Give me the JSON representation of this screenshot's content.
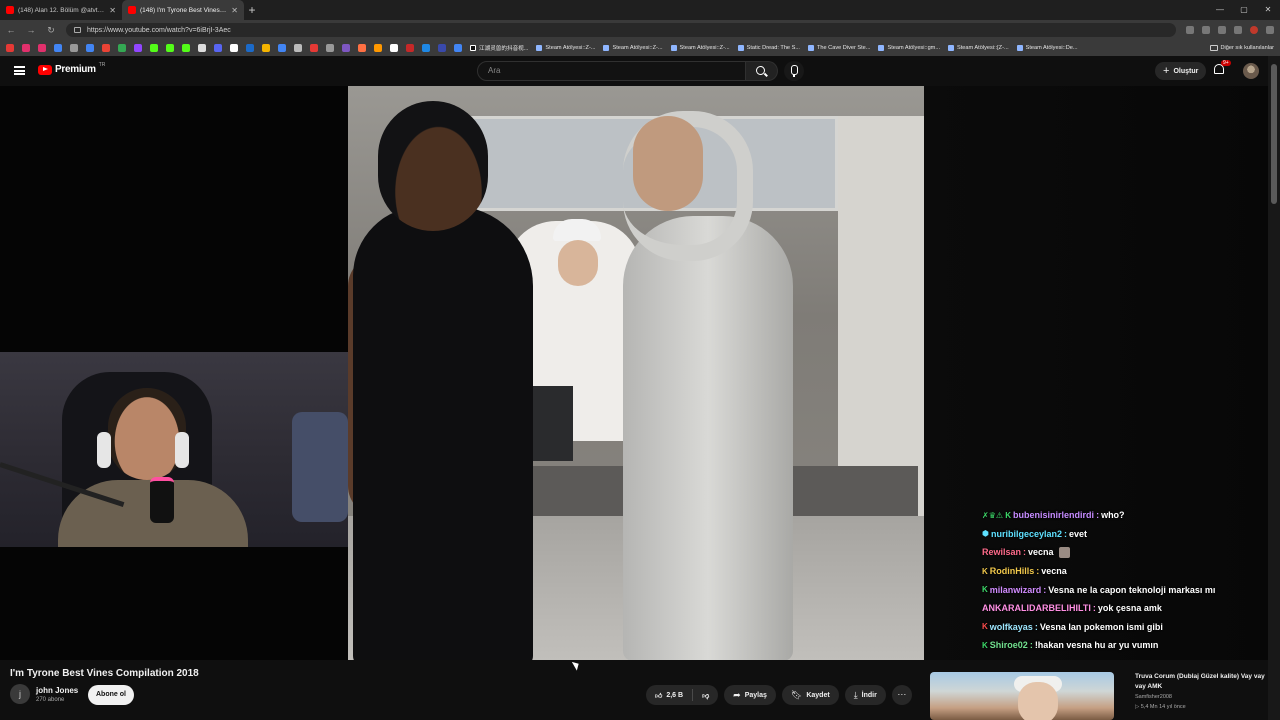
{
  "browser": {
    "tabs": [
      {
        "title": "(148) Alan 12. Bölüm @atvturkiye",
        "active": false
      },
      {
        "title": "(148) I'm Tyrone Best Vines Co",
        "active": true
      }
    ],
    "new_tab": "+",
    "url": "https://www.youtube.com/watch?v=6iBrjI-3Aec",
    "bookmarks": [
      "江湖灵兽的抖音视...",
      "Steam Atölyesi::Z-...",
      "Steam Atölyesi::Z-...",
      "Steam Atölyesi::Z-...",
      "Static Dread: The S...",
      "The Cave Diver Ste...",
      "Steam Atölyesi::gm...",
      "Steam Atölyesi::[Z-...",
      "Steam Atölyesi::De..."
    ],
    "bookmarks_other": "Diğer sık kullanılanlar"
  },
  "youtube": {
    "logo_text": "Premium",
    "logo_region": "TR",
    "search_placeholder": "Ara",
    "create_label": "Oluştur",
    "notif_count": "9+"
  },
  "chat": [
    {
      "badges": "✗♛⚠ K",
      "user": "bubenisinirlendirdi",
      "color": "#c58bff",
      "text": "who?"
    },
    {
      "badges": "⬢",
      "user": "nuribilgeceylan2",
      "color": "#5ee0ff",
      "text": "evet"
    },
    {
      "badges": "",
      "user": "Rewilsan",
      "color": "#ff6b8b",
      "text": "vecna",
      "emote": true
    },
    {
      "badges": "K",
      "user": "RodinHills",
      "color": "#f2c94c",
      "text": "vecna"
    },
    {
      "badges": "K",
      "user": "milanwizard",
      "color": "#d18cff",
      "text": "Vesna ne la capon teknoloji markası mı"
    },
    {
      "badges": "",
      "user": "ANKARALIDARBELIHILTI",
      "color": "#ff8fe3",
      "text": "yok çesna amk"
    },
    {
      "badges": "K",
      "user": "wolfkayas",
      "color": "#9ee7ff",
      "text": "Vesna  lan pokemon ismi gibi",
      "emote_mid": true
    },
    {
      "badges": "K",
      "user": "Shiroe02",
      "color": "#72e08f",
      "text": "!hakan vesna hu ar yu vumın"
    }
  ],
  "video": {
    "title": "I'm Tyrone Best Vines Compilation 2018",
    "channel_initial": "j",
    "channel": "john Jones",
    "subscribers": "270 abone",
    "subscribe_label": "Abone ol",
    "likes": "2,6 B",
    "share_label": "Paylaş",
    "save_label": "Kaydet",
    "download_label": "İndir",
    "more_label": "···"
  },
  "recommendation": {
    "title": "Truva Corum (Dublaj Güzel kalite)  Vay vay vay AMK",
    "channel": "Samfisher2008",
    "meta": "▷ 5,4 Mn   14 yıl önce"
  }
}
